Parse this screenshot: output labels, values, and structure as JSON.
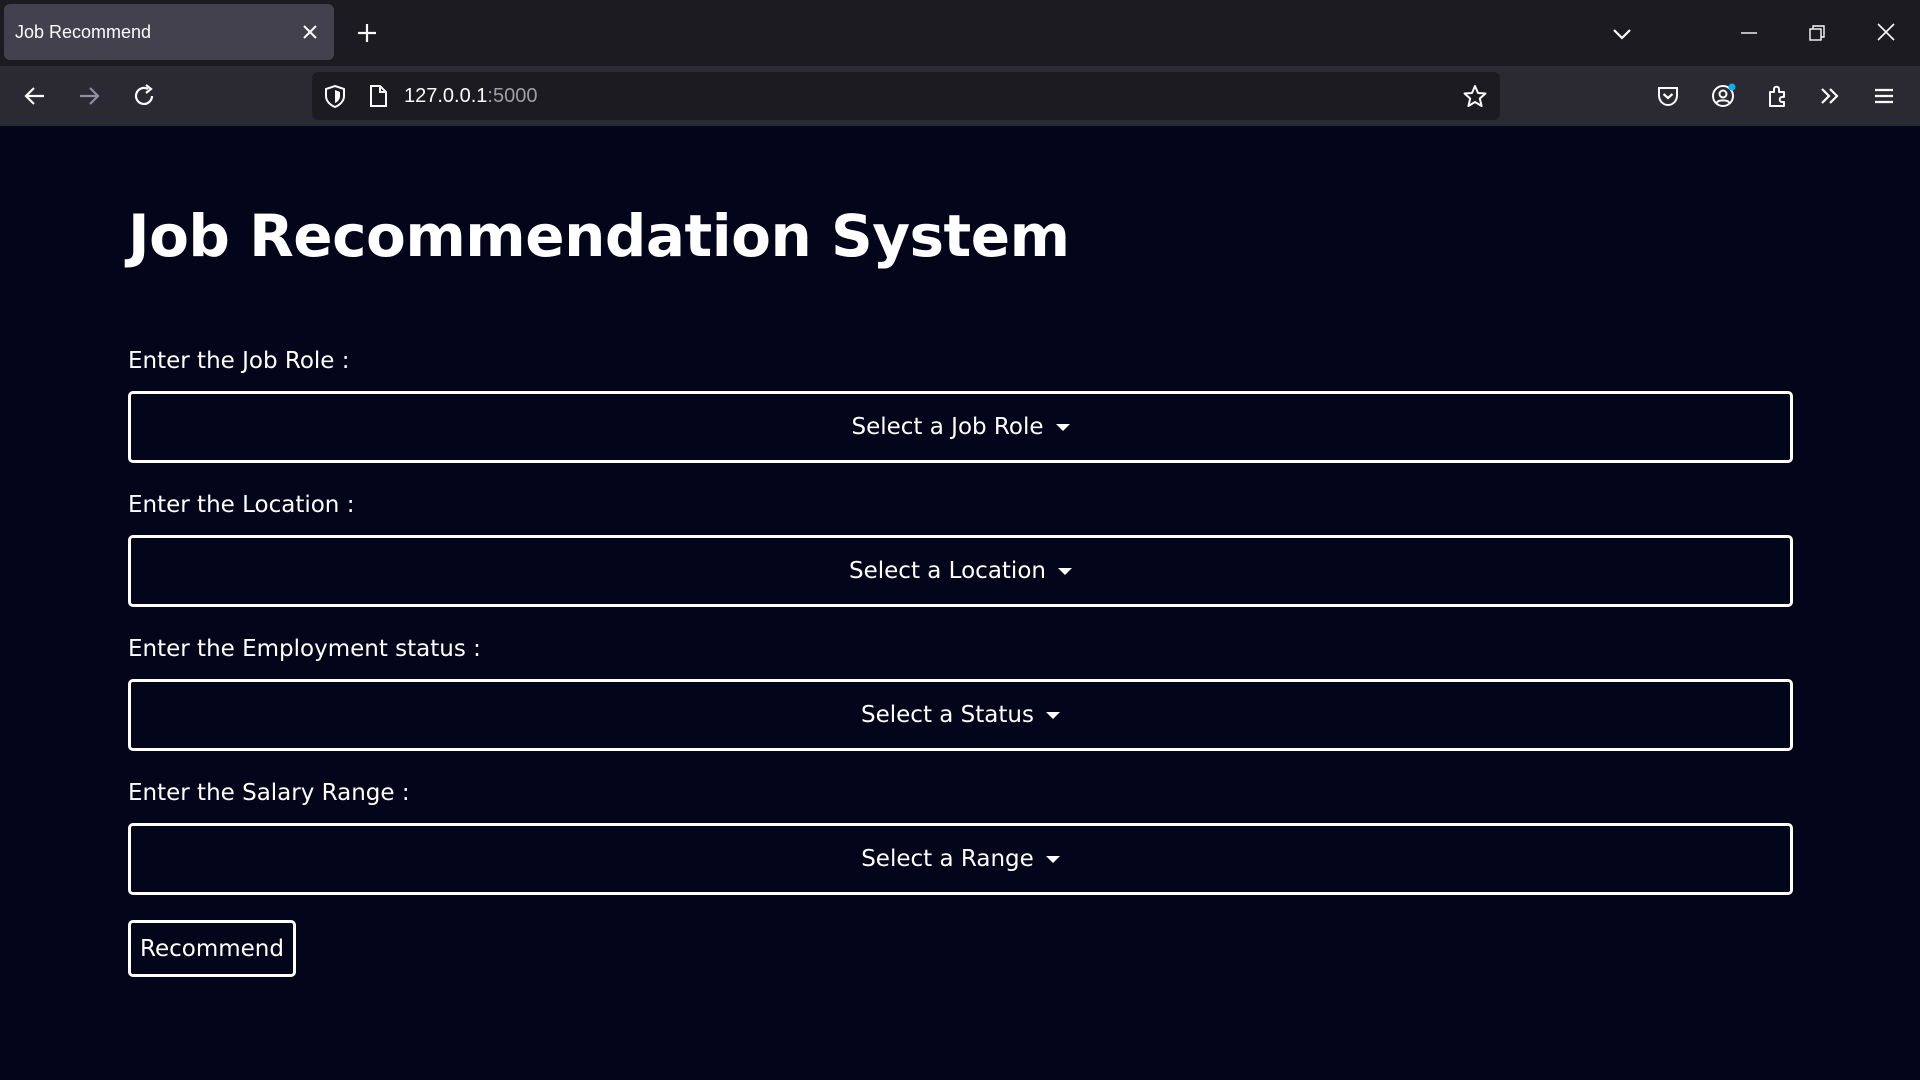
{
  "browser": {
    "tab_title": "Job Recommend",
    "url_host": "127.0.0.1",
    "url_port": ":5000"
  },
  "page": {
    "title": "Job Recommendation System",
    "fields": [
      {
        "label": "Enter the Job Role :",
        "selected": "Select a Job Role"
      },
      {
        "label": "Enter the Location :",
        "selected": "Select a Location"
      },
      {
        "label": "Enter the Employment status :",
        "selected": "Select a Status"
      },
      {
        "label": "Enter the Salary Range :",
        "selected": "Select a Range"
      }
    ],
    "submit_label": "Recommend"
  },
  "colors": {
    "page_background": "#03061a",
    "text": "#ffffff",
    "tabstrip": "#1c1b22",
    "navbar": "#2b2a33",
    "active_tab": "#42414d"
  },
  "icons": [
    "close-icon",
    "plus-icon",
    "chevron-down-icon",
    "minimize-icon",
    "restore-icon",
    "back-icon",
    "forward-icon",
    "reload-icon",
    "shield-icon",
    "page-icon",
    "star-icon",
    "pocket-icon",
    "account-icon",
    "extensions-icon",
    "overflow-icon",
    "menu-icon"
  ]
}
